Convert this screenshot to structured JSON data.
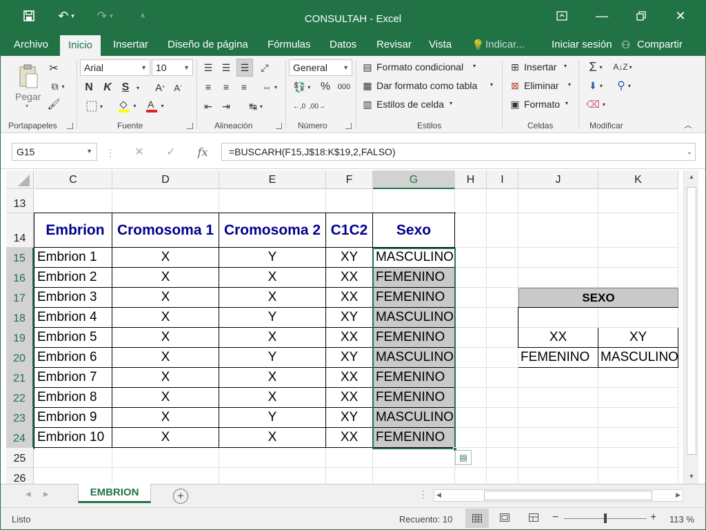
{
  "window": {
    "title": "CONSULTAH - Excel"
  },
  "tabs": [
    "Archivo",
    "Inicio",
    "Insertar",
    "Diseño de página",
    "Fórmulas",
    "Datos",
    "Revisar",
    "Vista",
    "Indicar...",
    "Iniciar sesión",
    "Compartir"
  ],
  "ribbon": {
    "clipboard": {
      "paste": "Pegar",
      "label": "Portapapeles"
    },
    "font": {
      "name": "Arial",
      "size": "10",
      "bold": "N",
      "italic": "K",
      "underline": "S",
      "label": "Fuente"
    },
    "alignment": {
      "label": "Alineación"
    },
    "number": {
      "format": "General",
      "label": "Número"
    },
    "styles": {
      "conditional": "Formato condicional",
      "table": "Dar formato como tabla",
      "cell_styles": "Estilos de celda",
      "label": "Estilos"
    },
    "cells": {
      "insert": "Insertar",
      "delete": "Eliminar",
      "format": "Formato",
      "label": "Celdas"
    },
    "edit": {
      "label": "Modificar"
    }
  },
  "formula_bar": {
    "name_box": "G15",
    "formula": "=BUSCARH(F15,J$18:K$19,2,FALSO)"
  },
  "columns": [
    "C",
    "D",
    "E",
    "F",
    "G",
    "H",
    "I",
    "J",
    "K"
  ],
  "rows": [
    "13",
    "14",
    "15",
    "16",
    "17",
    "18",
    "19",
    "20",
    "21",
    "22",
    "23",
    "24",
    "25",
    "26"
  ],
  "table": {
    "headers": [
      "Embrion",
      "Cromosoma 1",
      "Cromosoma 2",
      "C1C2",
      "Sexo"
    ],
    "rows": [
      [
        "Embrion 1",
        "X",
        "Y",
        "XY",
        "MASCULINO"
      ],
      [
        "Embrion 2",
        "X",
        "X",
        "XX",
        "FEMENINO"
      ],
      [
        "Embrion 3",
        "X",
        "X",
        "XX",
        "FEMENINO"
      ],
      [
        "Embrion 4",
        "X",
        "Y",
        "XY",
        "MASCULINO"
      ],
      [
        "Embrion 5",
        "X",
        "X",
        "XX",
        "FEMENINO"
      ],
      [
        "Embrion 6",
        "X",
        "Y",
        "XY",
        "MASCULINO"
      ],
      [
        "Embrion 7",
        "X",
        "X",
        "XX",
        "FEMENINO"
      ],
      [
        "Embrion 8",
        "X",
        "X",
        "XX",
        "FEMENINO"
      ],
      [
        "Embrion 9",
        "X",
        "Y",
        "XY",
        "MASCULINO"
      ],
      [
        "Embrion 10",
        "X",
        "X",
        "XX",
        "FEMENINO"
      ]
    ]
  },
  "lookup": {
    "title": "SEXO",
    "keys": [
      "XX",
      "XY"
    ],
    "values": [
      "FEMENINO",
      "MASCULINO"
    ]
  },
  "sheets": {
    "active": "EMBRION"
  },
  "status": {
    "ready": "Listo",
    "count": "Recuento: 10",
    "zoom": "113 %"
  },
  "colors": {
    "accent": "#217346",
    "header_text": "#00008b",
    "selection_fill": "#c9c9c9"
  }
}
